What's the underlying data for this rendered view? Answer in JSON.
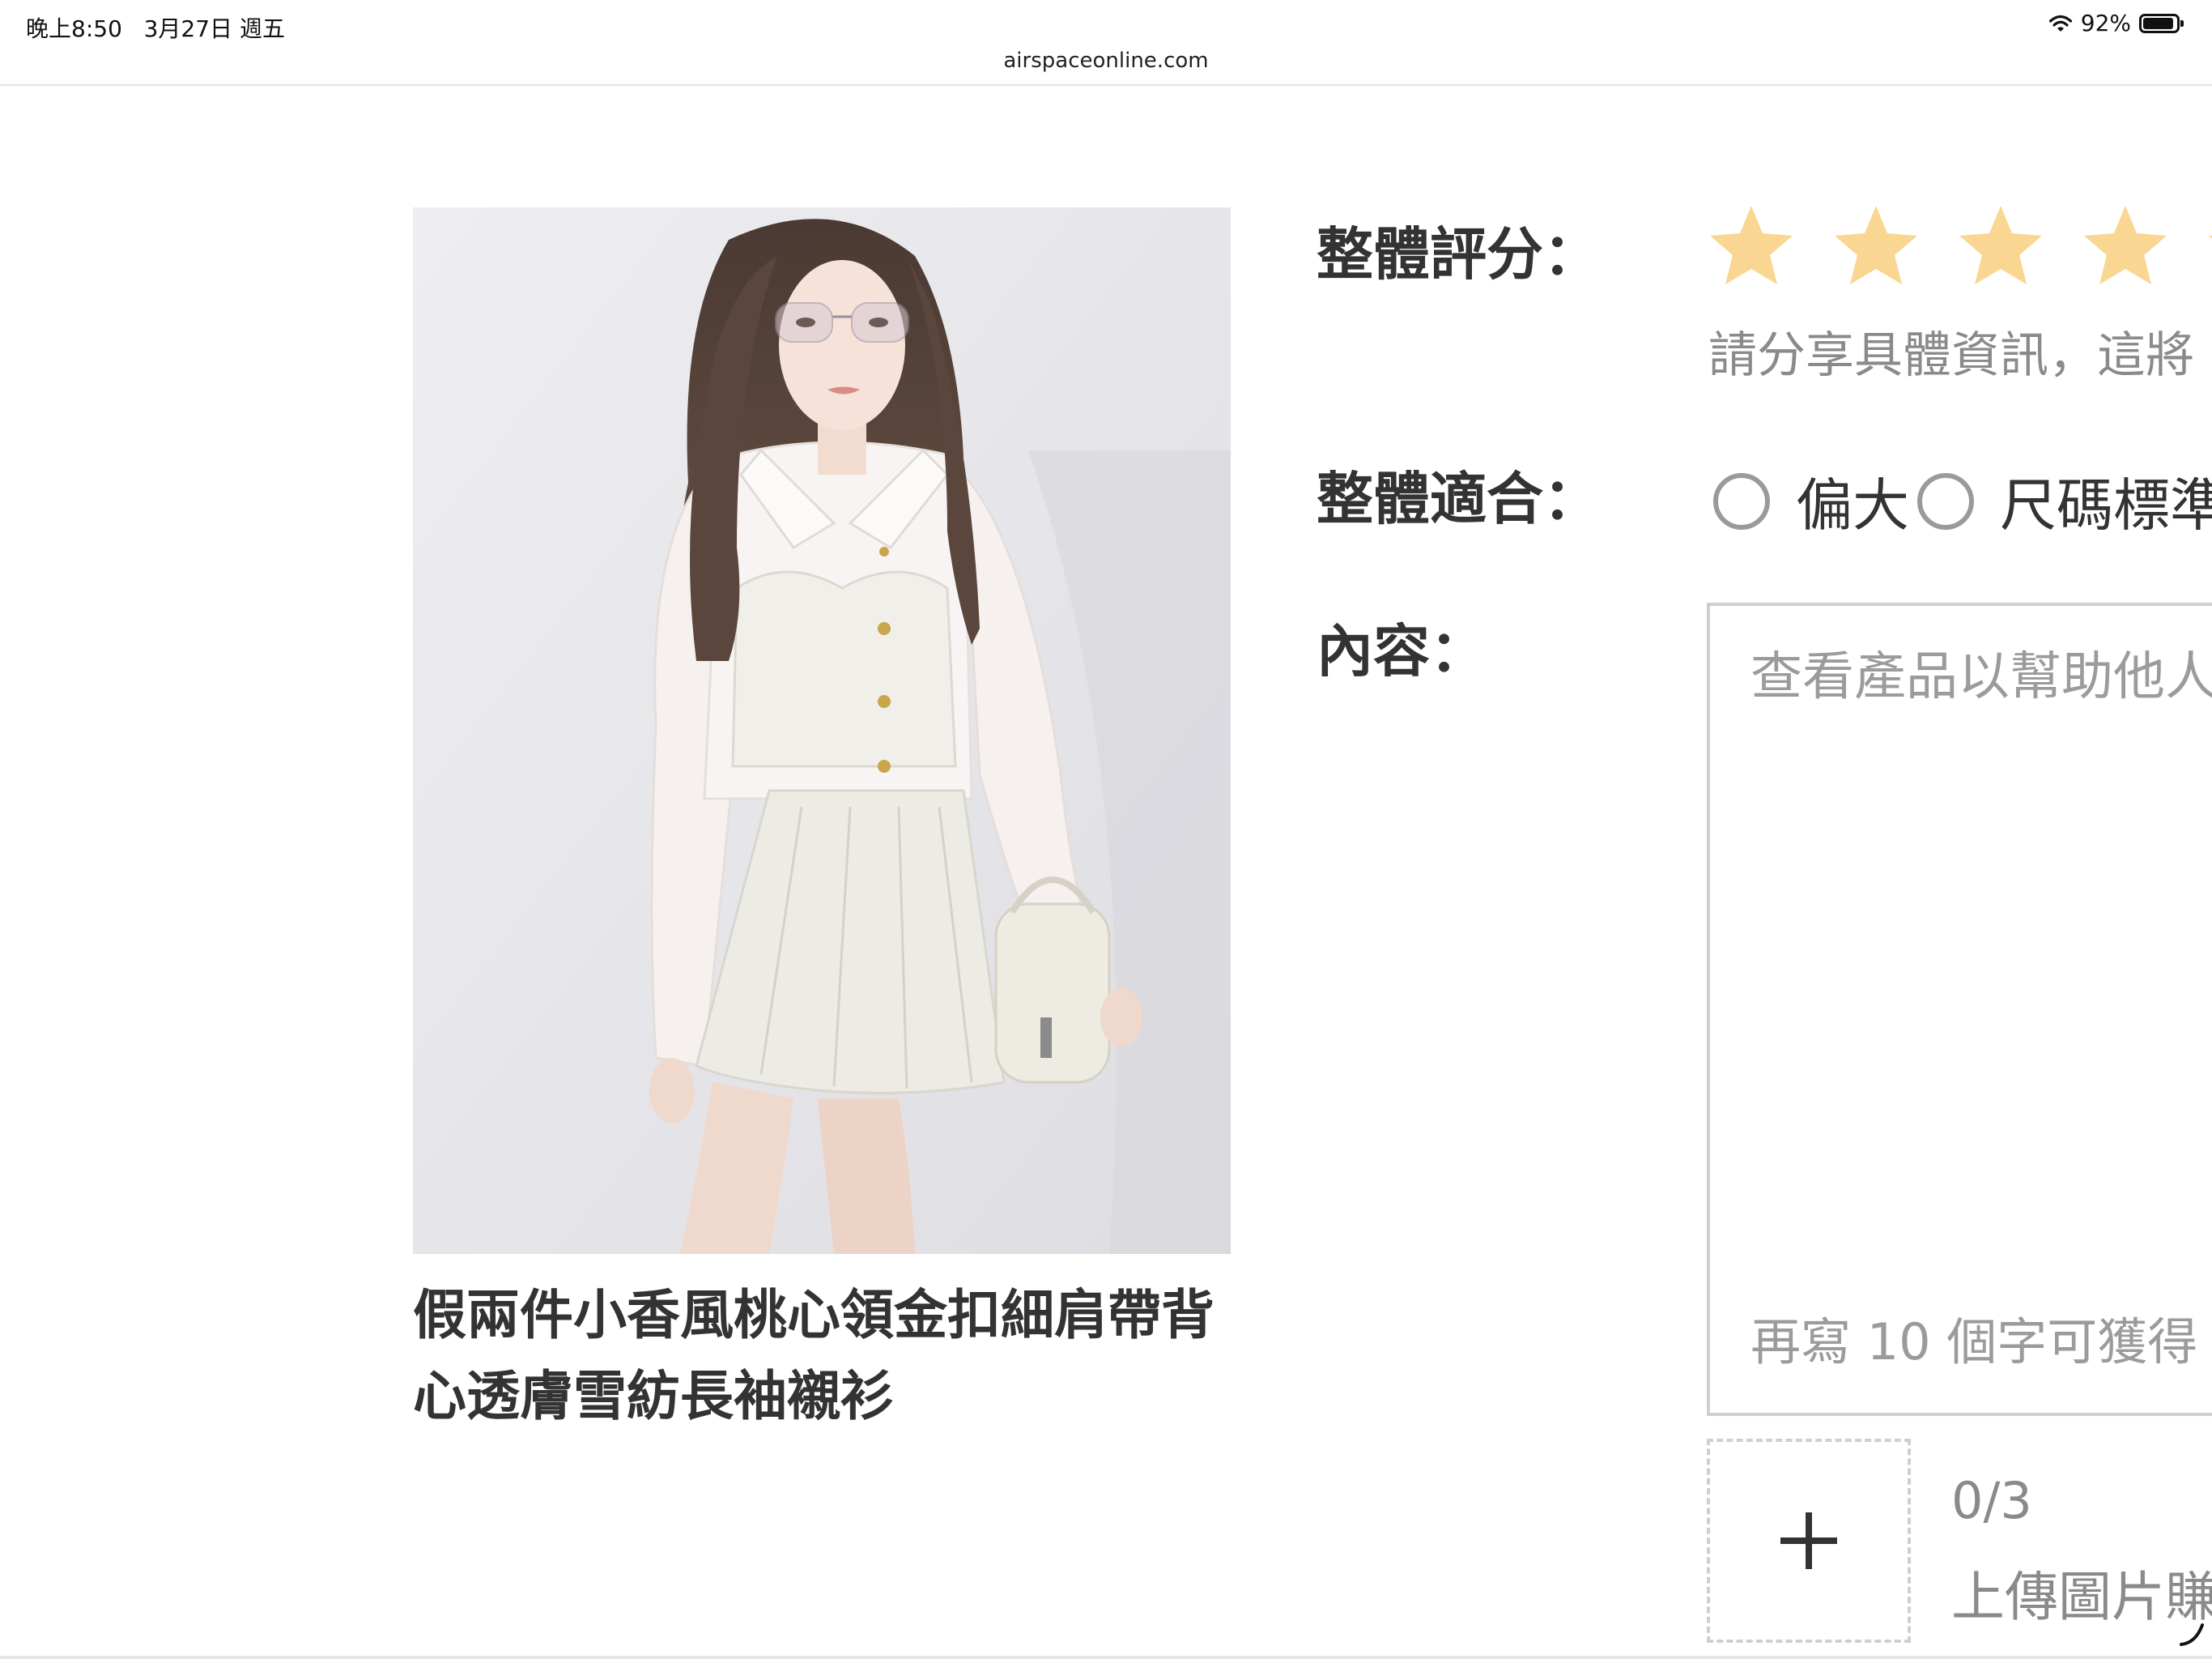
{
  "status_bar": {
    "time": "晚上8:50",
    "date": "3月27日 週五",
    "url": "airspaceonline.com",
    "battery_percent": "92%",
    "battery_level": 0.92
  },
  "product": {
    "title": "假兩件小香風桃心領金扣細肩帶背心透膚雪紡長袖襯衫"
  },
  "form": {
    "rating": {
      "label": "整體評分：",
      "hint": "請分享具體資訊，這將",
      "star_color": "#f9d691"
    },
    "fit": {
      "label": "整體適合：",
      "options": [
        "偏大",
        "尺碼標準"
      ]
    },
    "content": {
      "label": "內容：",
      "placeholder": "查看產品以幫助他人",
      "bonus_hint": "再寫 10 個字可獲得"
    },
    "upload": {
      "count": "0/3",
      "hint": "上傳圖片賺"
    }
  },
  "icons": {
    "wifi": "wifi-icon",
    "battery": "battery-icon",
    "star": "star-icon",
    "radio": "radio-unchecked-icon",
    "upload": "plus-icon",
    "resize": "resize-handle-icon"
  }
}
